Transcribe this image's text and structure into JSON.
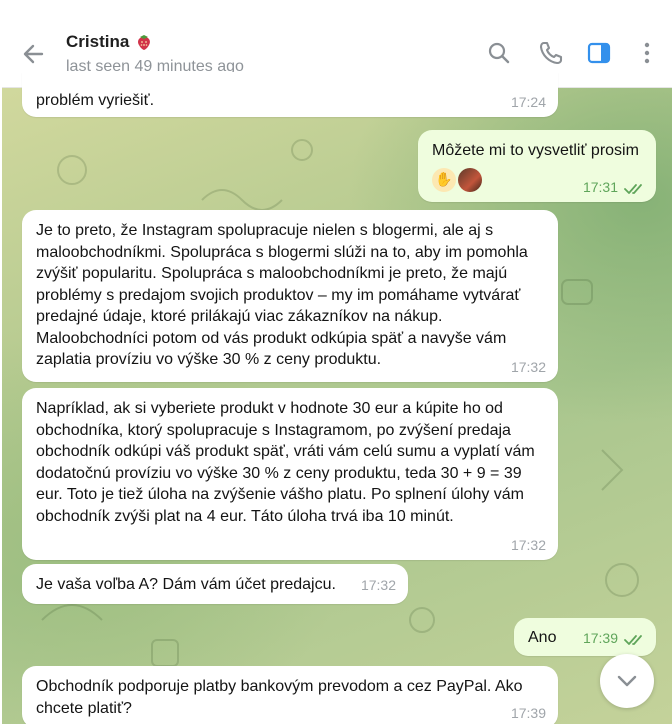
{
  "header": {
    "contact_name": "Cristina",
    "status": "last seen 49 minutes ago"
  },
  "messages": [
    {
      "text": "problém vyriešiť.",
      "time": "17:24",
      "direction": "in"
    },
    {
      "text": "Môžete mi to vysvetliť prosim",
      "time": "17:31",
      "direction": "out",
      "read": true,
      "reactions": [
        "hand-emoji",
        "avatar"
      ]
    },
    {
      "text": "Je to preto, že Instagram spolupracuje nielen s blogermi, ale aj s maloobchodníkmi. Spolupráca s blogermi slúži na to, aby im pomohla zvýšiť popularitu. Spolupráca s maloobchodníkmi je preto, že majú problémy s predajom svojich produktov – my im pomáhame vytvárať predajné údaje, ktoré prilákajú viac zákazníkov na nákup. Maloobchodníci potom od vás produkt odkúpia späť a navyše vám zaplatia províziu vo výške 30 % z ceny produktu.",
      "time": "17:32",
      "direction": "in"
    },
    {
      "text": "Napríklad, ak si vyberiete produkt v hodnote 30 eur a kúpite ho od obchodníka, ktorý spolupracuje s Instagramom, po zvýšení predaja obchodník odkúpi váš produkt späť, vráti vám celú sumu a vyplatí vám dodatočnú províziu vo výške 30 % z ceny produktu, teda 30 + 9 = 39 eur. Toto je tiež úloha na zvýšenie vášho platu. Po splnení úlohy vám obchodník zvýši plat na 4 eur. Táto úloha trvá iba 10 minút.",
      "time": "17:32",
      "direction": "in"
    },
    {
      "text": "Je vaša voľba A? Dám vám účet predajcu.",
      "time": "17:32",
      "direction": "in"
    },
    {
      "text": "Ano",
      "time": "17:39",
      "direction": "out",
      "read": true
    },
    {
      "text": "Obchodník podporuje platby bankovým prevodom a cez PayPal. Ako chcete platiť?",
      "time": "17:39",
      "direction": "in"
    }
  ],
  "icons": {
    "back": "back-arrow-icon",
    "search": "search-icon",
    "call": "phone-icon",
    "side_panel": "side-panel-icon",
    "more": "more-vertical-icon",
    "scroll_down": "chevron-down-icon"
  },
  "colors": {
    "accent": "#3390ec",
    "outgoing_bubble": "#effdde",
    "read_check": "#5fa55a"
  }
}
